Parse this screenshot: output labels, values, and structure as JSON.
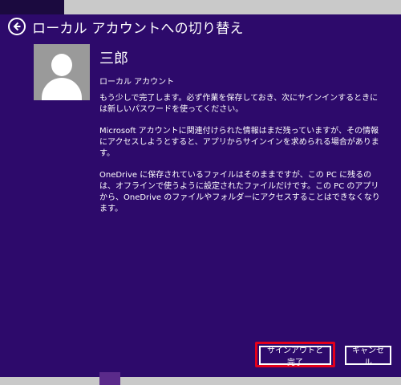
{
  "header": {
    "title": "ローカル アカウントへの切り替え"
  },
  "user": {
    "name": "三郎",
    "account_type": "ローカル アカウント"
  },
  "body": {
    "paragraphs": [
      "もう少しで完了します。必ず作業を保存しておき、次にサインインするときには新しいパスワードを使ってください。",
      "Microsoft アカウントに関連付けられた情報はまだ残っていますが、その情報にアクセスしようとすると、アプリからサインインを求められる場合があります。",
      "OneDrive に保存されているファイルはそのままですが、この PC に残るのは、オフラインで使うように設定されたファイルだけです。この PC のアプリから、OneDrive のファイルやフォルダーにアクセスすることはできなくなります。"
    ]
  },
  "buttons": {
    "primary_label": "サインアウトと完了",
    "secondary_label": "キャンセル"
  },
  "colors": {
    "background": "#2d0a6b",
    "highlight": "#e3001b",
    "avatar": "#9a9a9a"
  },
  "icons": {
    "back": "back-arrow-icon",
    "avatar": "user-silhouette-icon"
  }
}
